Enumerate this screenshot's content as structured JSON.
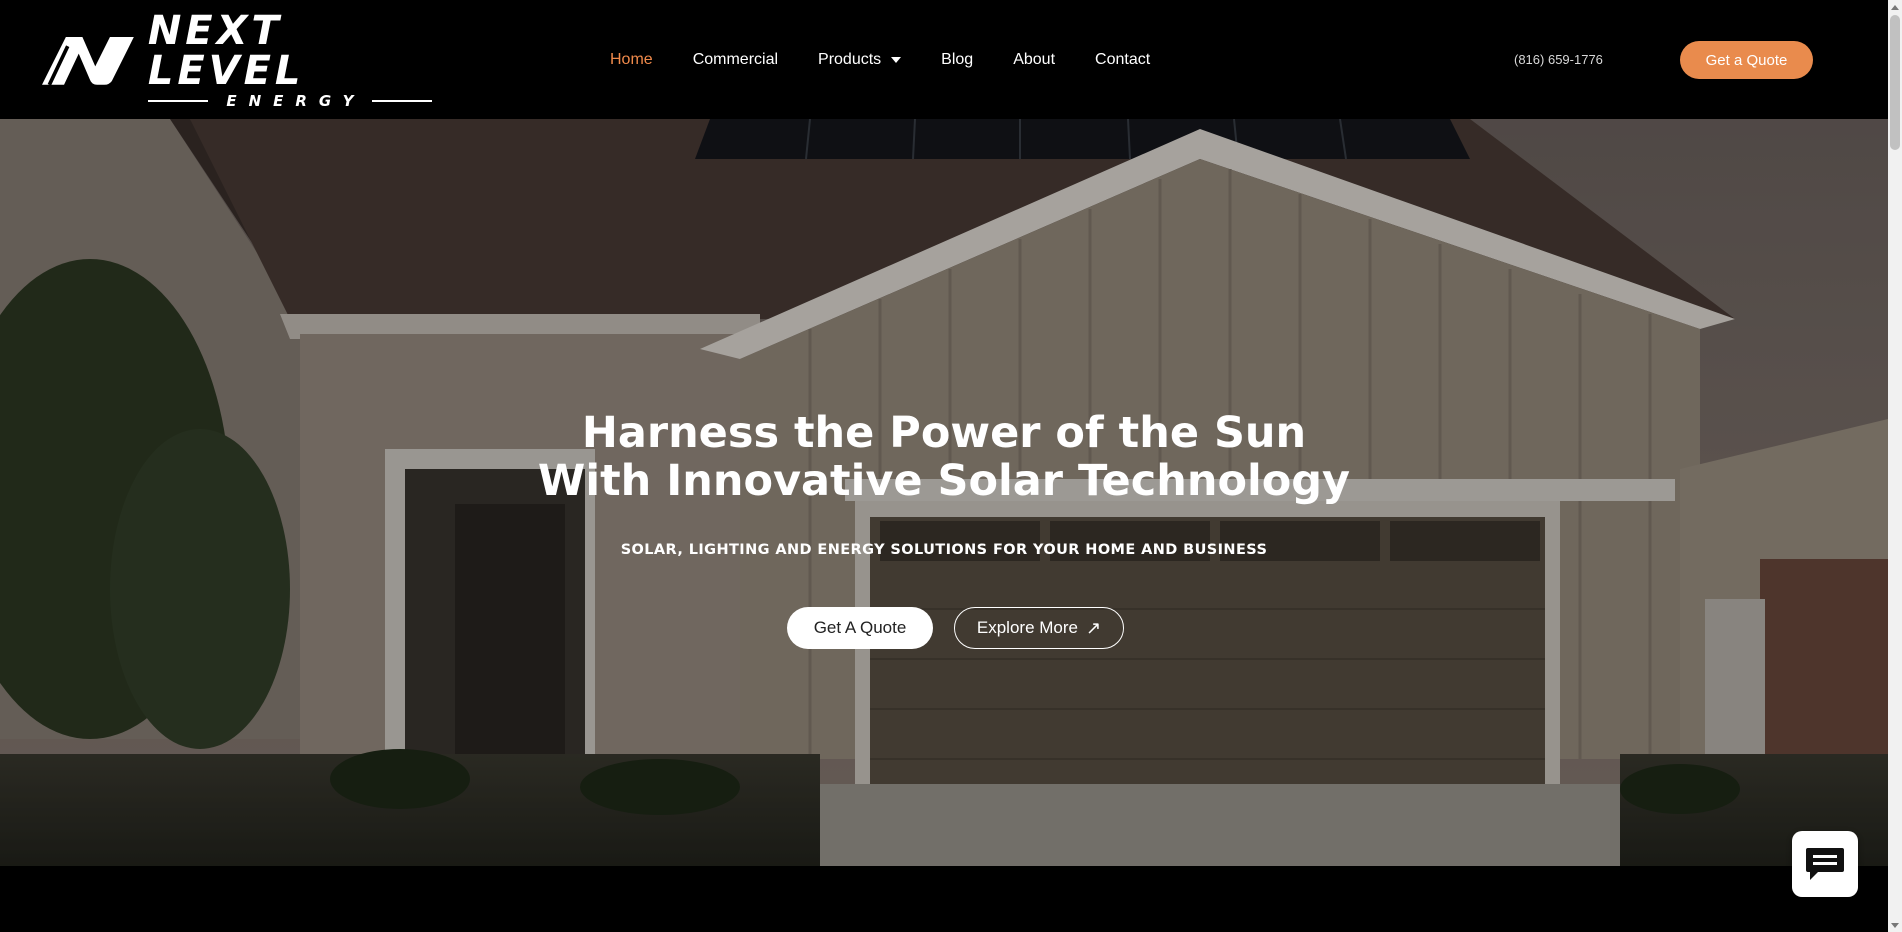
{
  "header": {
    "logo": {
      "main": "NEXT LEVEL",
      "sub": "ENERGY"
    },
    "nav": [
      {
        "label": "Home",
        "active": true
      },
      {
        "label": "Commercial"
      },
      {
        "label": "Products",
        "has_dropdown": true
      },
      {
        "label": "Blog"
      },
      {
        "label": "About"
      },
      {
        "label": "Contact"
      }
    ],
    "phone": "(816) 659-1776",
    "cta_label": "Get a Quote"
  },
  "hero": {
    "title_line1": "Harness the Power of the Sun",
    "title_line2": "With Innovative Solar Technology",
    "subtitle": "SOLAR, LIGHTING AND ENERGY SOLUTIONS FOR YOUR HOME AND BUSINESS",
    "primary_button": "Get A Quote",
    "secondary_button": "Explore More",
    "secondary_button_icon": "↗"
  },
  "chat_widget": {
    "icon": "chat-bubble-icon"
  },
  "colors": {
    "accent": "#e98b4d",
    "active_nav": "#f08a4b",
    "header_bg": "#000000"
  }
}
